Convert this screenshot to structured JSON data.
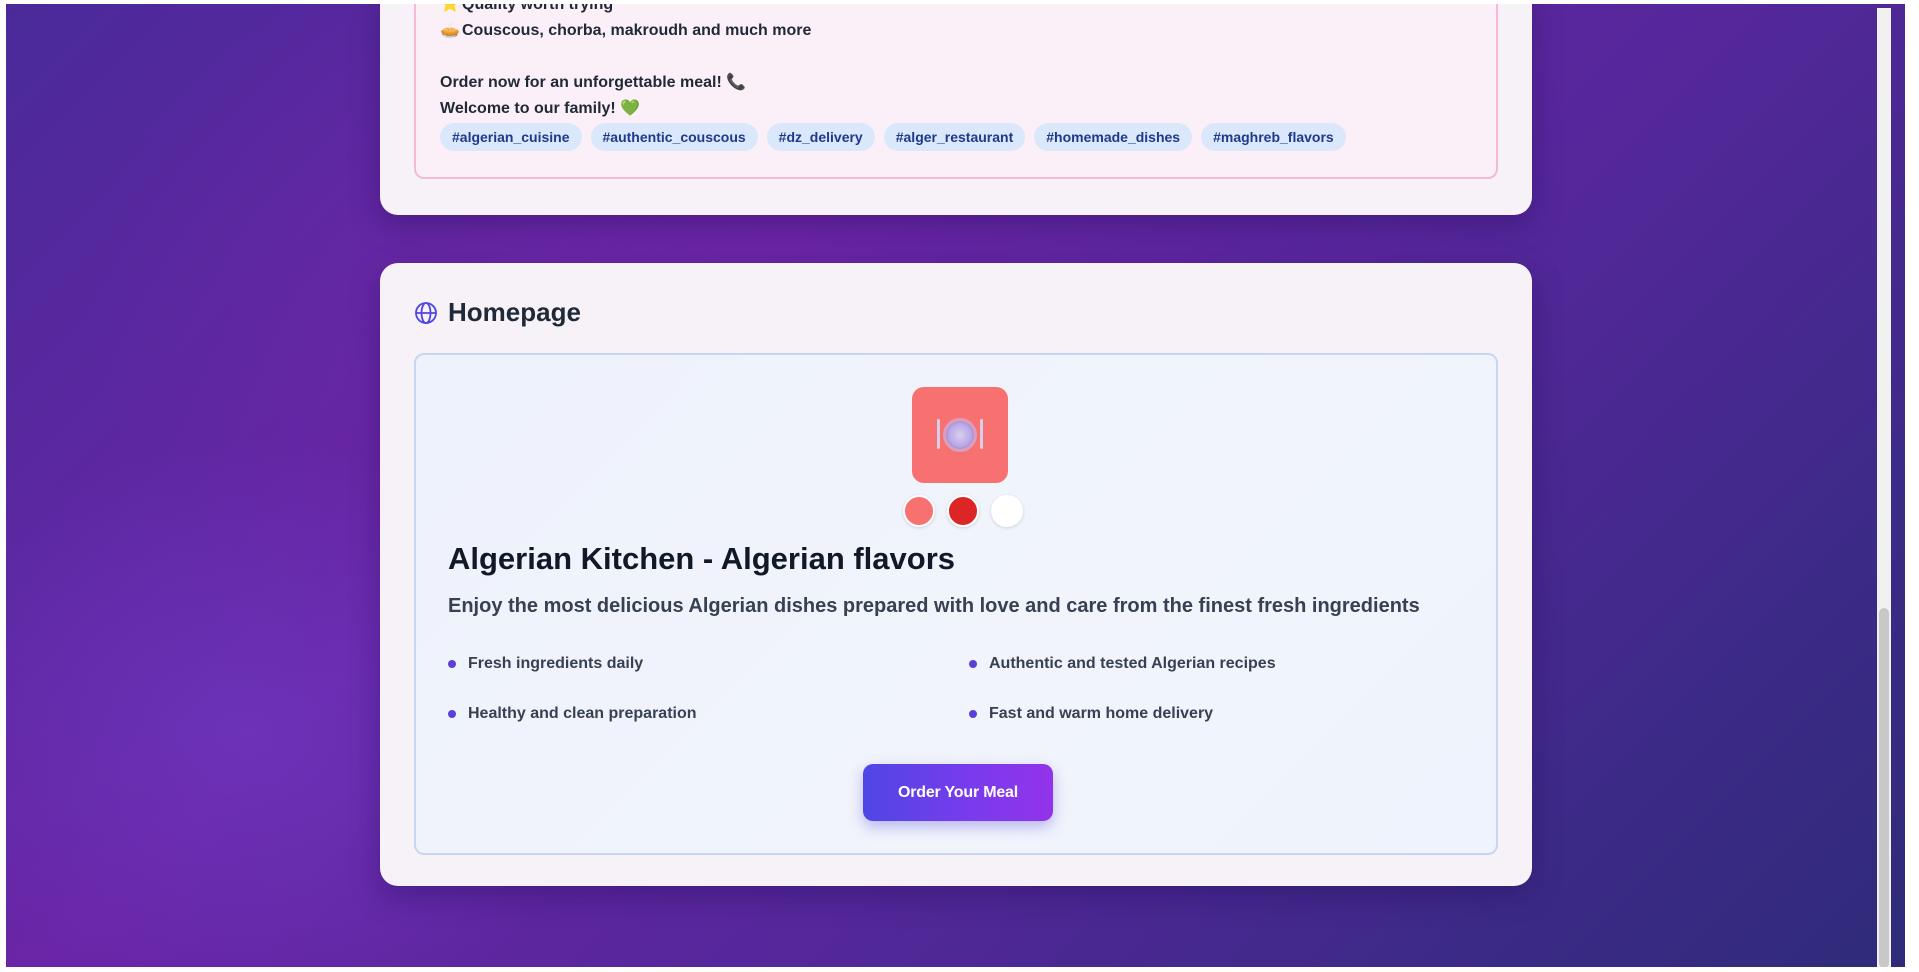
{
  "description": {
    "lines": [
      {
        "emoji": "⭐",
        "text": "Quality worth trying"
      },
      {
        "emoji": "🥧",
        "text": "Couscous, chorba, makroudh and much more"
      },
      {
        "emoji": "",
        "text": "Order now for an unforgettable meal! 📞"
      },
      {
        "emoji": "",
        "text": "Welcome to our family! 💚"
      }
    ],
    "tags": [
      "#algerian_cuisine",
      "#authentic_couscous",
      "#dz_delivery",
      "#alger_restaurant",
      "#homemade_dishes",
      "#maghreb_flavors"
    ]
  },
  "homepage": {
    "section_title": "Homepage",
    "section_icon": "globe-icon",
    "logo_icon": "plate-cutlery-icon",
    "swatches": [
      "#f87171",
      "#dc2626",
      "#ffffff"
    ],
    "title": "Algerian Kitchen - Algerian flavors",
    "subtitle": "Enjoy the most delicious Algerian dishes prepared with love and care from the finest fresh ingredients",
    "features": [
      "Fresh ingredients daily",
      "Authentic and tested Algerian recipes",
      "Healthy and clean preparation",
      "Fast and warm home delivery"
    ],
    "cta_label": "Order Your Meal"
  },
  "colors": {
    "accent": "#4f46e5",
    "logo_tile": "#f87171",
    "tag_bg": "#dbe7fb",
    "tag_text": "#1e3a8a"
  }
}
